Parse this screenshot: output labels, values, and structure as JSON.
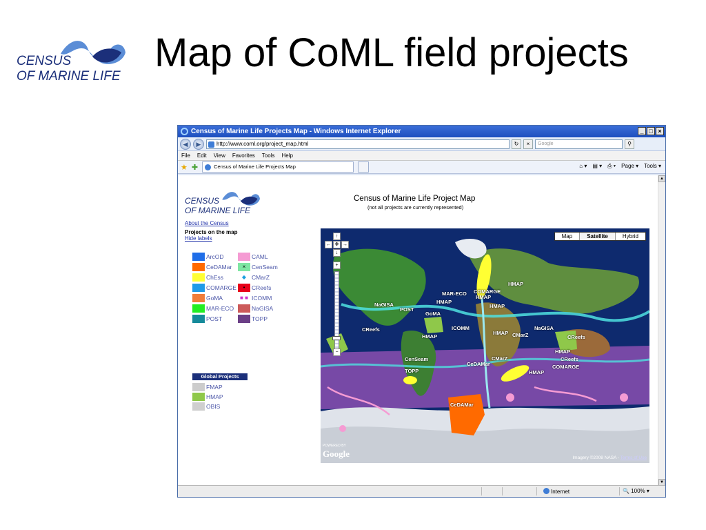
{
  "slide": {
    "title": "Map of CoML field projects",
    "logo_line1": "CENSUS",
    "logo_line2": "OF MARINE LIFE",
    "logo_color": "#1b2f7a",
    "logo_accent": "#5b8dd6"
  },
  "browser": {
    "window_title": "Census of Marine Life Projects Map - Windows Internet Explorer",
    "url": "http://www.coml.org/project_map.html",
    "search_placeholder": "Google",
    "menu": [
      "File",
      "Edit",
      "View",
      "Favorites",
      "Tools",
      "Help"
    ],
    "tab_title": "Census of Marine Life Projects Map",
    "commands": [
      "Page ▾",
      "Tools ▾"
    ],
    "status": {
      "zone": "Internet",
      "zoom": "100%"
    },
    "window_buttons": [
      "_",
      "□",
      "×"
    ],
    "nav_glyphs": {
      "back": "◀",
      "forward": "▶",
      "refresh": "↻",
      "stop": "×",
      "search_go": "⚲"
    }
  },
  "page": {
    "logo_line1": "CENSUS",
    "logo_line2": "OF MARINE LIFE",
    "about_link": "About the Census",
    "projects_heading": "Projects on the map",
    "hide_labels": "Hide labels",
    "title": "Census of Marine Life Project Map",
    "subtitle": "(not all projects are currently represented)",
    "legend": [
      {
        "left": {
          "label": "ArcOD",
          "color": "#1f6ee8"
        },
        "right": {
          "label": "CAML",
          "color": "#f59bd3"
        }
      },
      {
        "left": {
          "label": "CeDAMar",
          "color": "#ff6a00"
        },
        "right": {
          "label": "CenSeam",
          "color": "#7fe6a3",
          "icon": "×"
        }
      },
      {
        "left": {
          "label": "ChEss",
          "color": "#ffff33"
        },
        "right": {
          "label": "CMarZ",
          "color": "#ffffff",
          "icon": "◆",
          "icon_color": "#1aa0e0"
        }
      },
      {
        "left": {
          "label": "COMARGE",
          "color": "#1f9be8"
        },
        "right": {
          "label": "CReefs",
          "color": "#e8001a",
          "icon": "•"
        }
      },
      {
        "left": {
          "label": "GoMA",
          "color": "#f07d3a"
        },
        "right": {
          "label": "ICOMM",
          "color": "#ffffff",
          "icon": "■ ■",
          "icon_color": "#cc33cc"
        }
      },
      {
        "left": {
          "label": "MAR-ECO",
          "color": "#22ee22"
        },
        "right": {
          "label": "NaGISA",
          "color": "#cc5a5a"
        }
      },
      {
        "left": {
          "label": "POST",
          "color": "#158a9a"
        },
        "right": {
          "label": "TOPP",
          "color": "#6b3f86"
        }
      }
    ],
    "global_heading": "Global Projects",
    "global": [
      {
        "label": "FMAP",
        "color": "#cccccc"
      },
      {
        "label": "HMAP",
        "color": "#8fc84a"
      },
      {
        "label": "OBIS",
        "color": "#cfcfcf"
      }
    ]
  },
  "map": {
    "types": [
      "Map",
      "Satellite",
      "Hybrid"
    ],
    "active_type": "Satellite",
    "labels": [
      "HMAP",
      "MAR-ECO",
      "COMARGE",
      "HMAP",
      "HMAP",
      "HMAP",
      "NaGISA",
      "POST",
      "GoMA",
      "ICOMM",
      "CReefs",
      "HMAP",
      "HMAP",
      "CMarZ",
      "NaGISA",
      "CReefs",
      "HMAP",
      "CReefs",
      "COMARGE",
      "CenSeam",
      "CeDAMar",
      "CMarZ",
      "HMAP",
      "TOPP",
      "CeDAMar"
    ],
    "powered_by": "POWERED BY",
    "google": "Google",
    "attribution": "Imagery ©2008 NASA - ",
    "terms": "Terms of Use",
    "controls": {
      "up": "↑",
      "left": "←",
      "center": "✥",
      "right": "→",
      "down": "↓",
      "zoom_in": "+",
      "zoom_out": "−"
    },
    "colors": {
      "ocean": "#0e2a6e",
      "land": "#2f8a2f",
      "ice": "#dfe3ea",
      "overlay_purple": "#8a4fb0",
      "overlay_cyan": "#4fe0e0"
    }
  }
}
